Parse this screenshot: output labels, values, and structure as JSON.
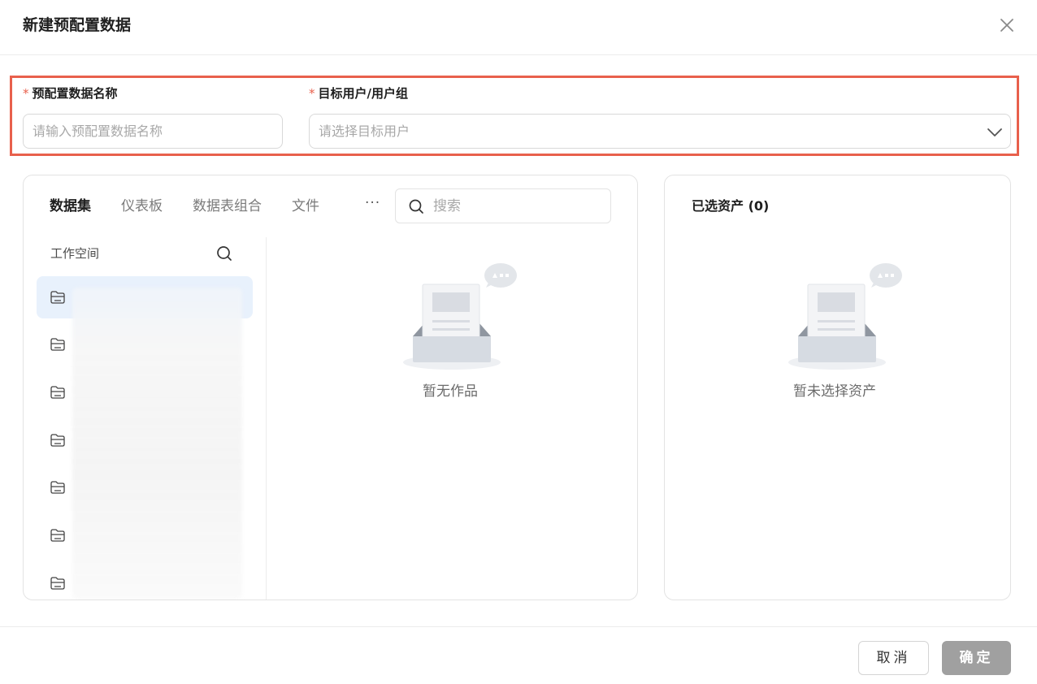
{
  "dialog": {
    "title": "新建预配置数据"
  },
  "form": {
    "name_label": "预配置数据名称",
    "name_placeholder": "请输入预配置数据名称",
    "target_label": "目标用户/用户组",
    "target_placeholder": "请选择目标用户",
    "required_mark": "*",
    "highlight_color": "#e8604c"
  },
  "assets": {
    "tabs": [
      {
        "label": "数据集",
        "active": true
      },
      {
        "label": "仪表板",
        "active": false
      },
      {
        "label": "数据表组合",
        "active": false
      },
      {
        "label": "文件",
        "active": false
      }
    ],
    "more_label": "···",
    "search_placeholder": "搜索",
    "sidebar_title": "工作空间",
    "folders_count_visible": 7,
    "empty_text": "暂无作品"
  },
  "selected": {
    "title": "已选资产 (0)",
    "empty_text": "暂未选择资产"
  },
  "footer": {
    "cancel_label": "取消",
    "ok_label": "确定"
  }
}
